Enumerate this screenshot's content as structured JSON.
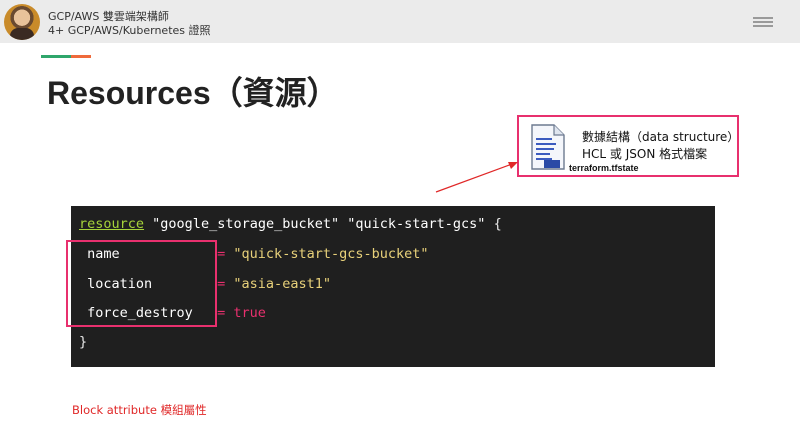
{
  "header": {
    "author_line1": "GCP/AWS 雙雲端架構師",
    "author_line2": "4+ GCP/AWS/Kubernetes 證照"
  },
  "slide": {
    "title": "Resources（資源）",
    "callout": {
      "line1": "數據結構（data structure）",
      "line2": "HCL 或 JSON 格式檔案",
      "filename": "terraform.tfstate"
    },
    "code": {
      "keyword": "resource",
      "type": "\"google_storage_bucket\"",
      "name": "\"quick-start-gcs\"",
      "open_brace": "{",
      "attributes": [
        {
          "key": "name",
          "value": "\"quick-start-gcs-bucket\""
        },
        {
          "key": "location",
          "value": "\"asia-east1\""
        },
        {
          "key": "force_destroy",
          "value": "true"
        }
      ],
      "equals": "=",
      "close_brace": "}"
    },
    "caption": "Block attribute 模組屬性"
  },
  "colors": {
    "accent_green": "#2fa66b",
    "accent_orange": "#ef6a3b",
    "highlight_pink": "#e8306e",
    "code_bg": "#1f1f1f",
    "caption_red": "#e02828"
  },
  "icons": {
    "avatar": "author-avatar",
    "menu": "hamburger-menu-icon",
    "file": "document-file-icon"
  }
}
